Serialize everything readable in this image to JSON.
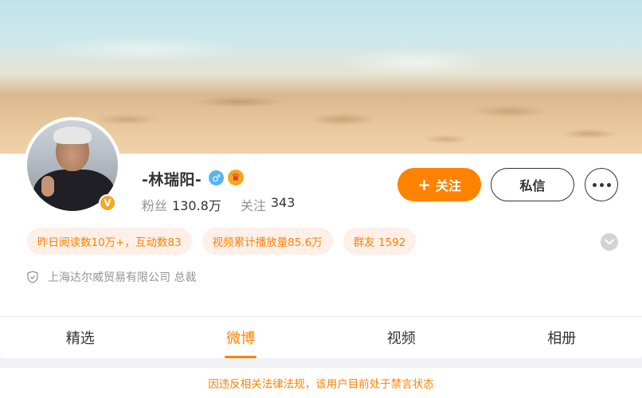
{
  "profile": {
    "name": "-林瑞阳-",
    "verified_badge": "V",
    "gender_icon": "male-icon",
    "vip_icon": "crown-icon",
    "colors": {
      "accent": "#ff8200",
      "gender": "#59b4ec",
      "vip": "#f5a623",
      "verified": "#f5a623"
    }
  },
  "stats": {
    "followers_label": "粉丝",
    "followers_value": "130.8万",
    "following_label": "关注",
    "following_value": "343"
  },
  "actions": {
    "follow_icon": "plus-icon",
    "follow_label": "关注",
    "message_label": "私信",
    "more_icon": "more-dots-icon"
  },
  "tags": [
    {
      "label": "昨日阅读数10万+，互动数83"
    },
    {
      "label": "视频累计播放量85.6万"
    },
    {
      "label": "群友 1592"
    }
  ],
  "expand_icon": "chevron-down-icon",
  "company": {
    "icon": "shield-icon",
    "text": "上海达尔威贸易有限公司 总裁"
  },
  "tabs": [
    {
      "label": "精选",
      "active": false
    },
    {
      "label": "微博",
      "active": true
    },
    {
      "label": "视频",
      "active": false
    },
    {
      "label": "相册",
      "active": false
    }
  ],
  "notice": "因违反相关法律法规，该用户目前处于禁言状态"
}
